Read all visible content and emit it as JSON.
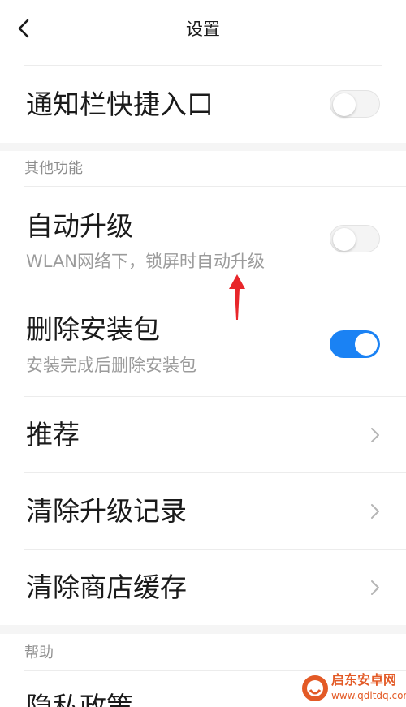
{
  "header": {
    "title": "设置"
  },
  "rows": [
    {
      "title": "通知栏快捷入口",
      "toggle": "off"
    }
  ],
  "sections": [
    {
      "header": "其他功能",
      "items": [
        {
          "title": "自动升级",
          "subtitle": "WLAN网络下，锁屏时自动升级",
          "toggle": "off"
        },
        {
          "title": "删除安装包",
          "subtitle": "安装完成后删除安装包",
          "toggle": "on"
        },
        {
          "title": "推荐"
        },
        {
          "title": "清除升级记录"
        },
        {
          "title": "清除商店缓存"
        }
      ]
    },
    {
      "header": "帮助",
      "items": [
        {
          "title": "隐私政策"
        }
      ]
    }
  ],
  "watermark": {
    "text": "启东安卓网",
    "url": "www.qdltdq.com"
  },
  "colors": {
    "toggle_on": "#1a82f4",
    "annotation_arrow": "#e8262a",
    "section_gap": "#f5f5f5",
    "watermark": "#e35a26"
  }
}
